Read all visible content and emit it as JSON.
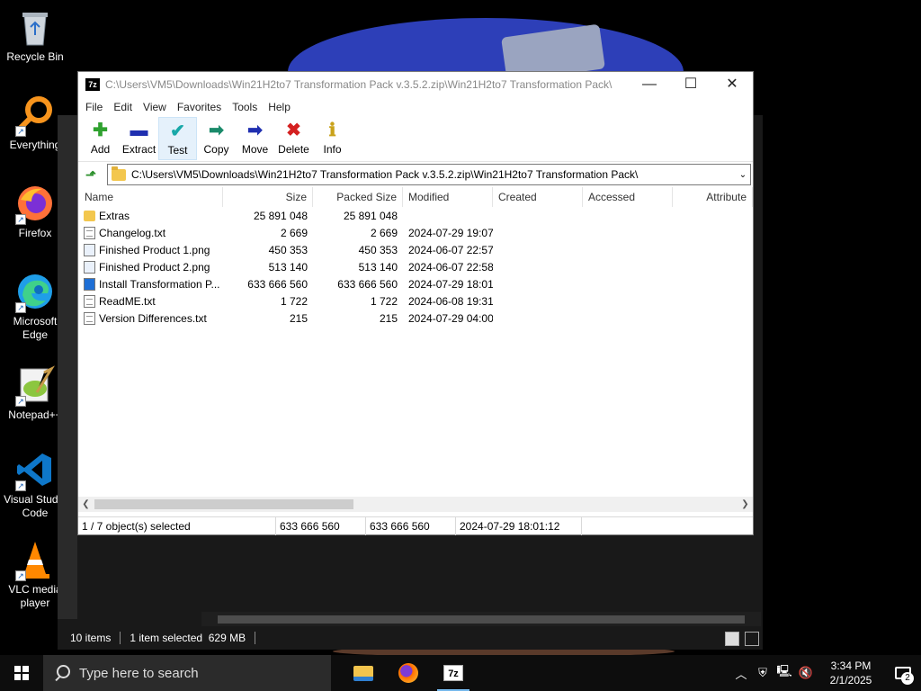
{
  "desktop": {
    "icons": [
      {
        "label": "Recycle Bin"
      },
      {
        "label": "Everything"
      },
      {
        "label": "Firefox"
      },
      {
        "label": "Microsoft Edge"
      },
      {
        "label": "Notepad++"
      },
      {
        "label": "Visual Studio Code"
      },
      {
        "label": "VLC media player"
      }
    ]
  },
  "explorer_bg": {
    "status_items": "10 items",
    "status_selected": "1 item selected  629 MB"
  },
  "sevenzip": {
    "title": "C:\\Users\\VM5\\Downloads\\Win21H2to7 Transformation Pack v.3.5.2.zip\\Win21H2to7 Transformation Pack\\",
    "app_icon_text": "7z",
    "menu": [
      "File",
      "Edit",
      "View",
      "Favorites",
      "Tools",
      "Help"
    ],
    "toolbar": [
      {
        "label": "Add",
        "icon": "plus-icon",
        "color": "#2fa12f",
        "glyph": "✚"
      },
      {
        "label": "Extract",
        "icon": "minus-icon",
        "color": "#1f2fb0",
        "glyph": "▬"
      },
      {
        "label": "Test",
        "icon": "check-icon",
        "color": "#18a8a8",
        "glyph": "✔"
      },
      {
        "label": "Copy",
        "icon": "copy-arrow-icon",
        "color": "#1a8a6a",
        "glyph": "➡"
      },
      {
        "label": "Move",
        "icon": "move-arrow-icon",
        "color": "#1f2fb0",
        "glyph": "➡"
      },
      {
        "label": "Delete",
        "icon": "delete-x-icon",
        "color": "#d42020",
        "glyph": "✖"
      },
      {
        "label": "Info",
        "icon": "info-icon",
        "color": "#c9a21a",
        "glyph": "ℹ"
      }
    ],
    "address": "C:\\Users\\VM5\\Downloads\\Win21H2to7 Transformation Pack v.3.5.2.zip\\Win21H2to7 Transformation Pack\\",
    "columns": [
      "Name",
      "Size",
      "Packed Size",
      "Modified",
      "Created",
      "Accessed",
      "Attribute"
    ],
    "files": [
      {
        "name": "Extras",
        "type": "folder",
        "size": "25 891 048",
        "packed": "25 891 048",
        "modified": ""
      },
      {
        "name": "Changelog.txt",
        "type": "txt",
        "size": "2 669",
        "packed": "2 669",
        "modified": "2024-07-29 19:07"
      },
      {
        "name": "Finished Product 1.png",
        "type": "img",
        "size": "450 353",
        "packed": "450 353",
        "modified": "2024-06-07 22:57"
      },
      {
        "name": "Finished Product 2.png",
        "type": "img",
        "size": "513 140",
        "packed": "513 140",
        "modified": "2024-06-07 22:58"
      },
      {
        "name": "Install Transformation P...",
        "type": "exe",
        "size": "633 666 560",
        "packed": "633 666 560",
        "modified": "2024-07-29 18:01"
      },
      {
        "name": "ReadME.txt",
        "type": "txt",
        "size": "1 722",
        "packed": "1 722",
        "modified": "2024-06-08 19:31"
      },
      {
        "name": "Version Differences.txt",
        "type": "txt",
        "size": "215",
        "packed": "215",
        "modified": "2024-07-29 04:00"
      }
    ],
    "status": {
      "selection": "1 / 7 object(s) selected",
      "size": "633 666 560",
      "packed": "633 666 560",
      "modified": "2024-07-29 18:01:12"
    }
  },
  "taskbar": {
    "search_placeholder": "Type here to search",
    "time": "3:34 PM",
    "date": "2/1/2025",
    "notification_count": "2"
  }
}
